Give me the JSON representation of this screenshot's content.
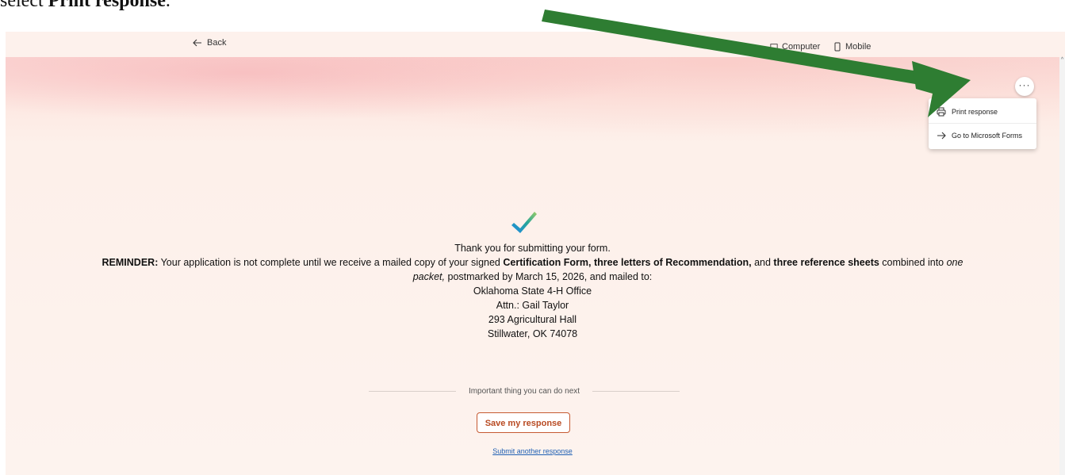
{
  "caption": {
    "prefix": "select ",
    "bold": "Print response",
    "suffix": "."
  },
  "toolbar": {
    "back_label": "Back",
    "tab_computer": "Computer",
    "tab_mobile": "Mobile"
  },
  "menu": {
    "more_label": "···",
    "items": [
      {
        "label": "Print response",
        "icon": "printer-icon"
      },
      {
        "label": "Go to Microsoft Forms",
        "icon": "arrow-right-icon"
      }
    ]
  },
  "message": {
    "thanks": "Thank you for submitting your form.",
    "reminder_label": "REMINDER:",
    "reminder_text_1": " Your application is not complete until we receive a mailed copy of your signed ",
    "cert_form": "Certification Form, three letters of Recommendation,",
    "and_1": " and ",
    "ref_sheets": "three reference sheets",
    "combined_into": " combined into ",
    "one": "one",
    "packet": "packet,",
    "postmarked": " postmarked by March 15, 2026, and mailed to:",
    "address": [
      "Oklahoma State 4-H Office",
      "Attn.: Gail Taylor",
      "293 Agricultural Hall",
      "Stillwater, OK 74078"
    ]
  },
  "next": {
    "divider_text": "Important thing you can do next",
    "save_label": "Save my response",
    "submit_another": "Submit another response"
  },
  "colors": {
    "accent": "#c65a32",
    "annotation_arrow": "#2e7d32",
    "link": "#1f5fb3"
  }
}
